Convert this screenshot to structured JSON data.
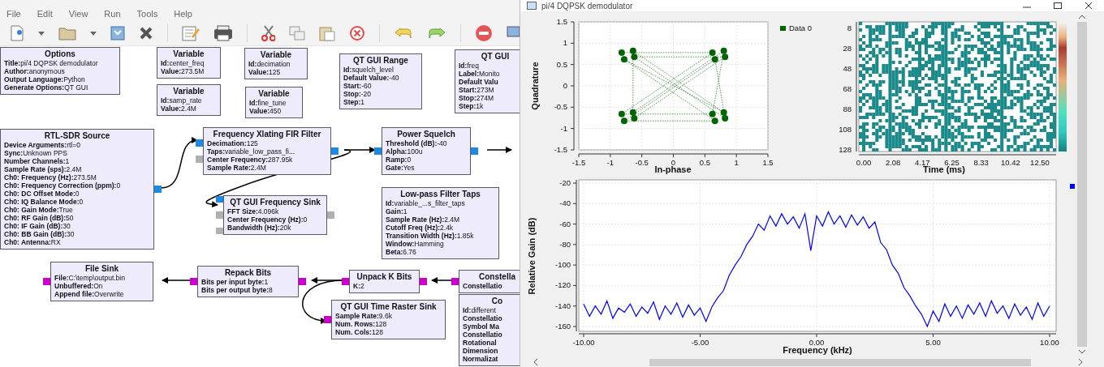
{
  "flowgraph_window": {
    "menu": [
      "File",
      "Edit",
      "View",
      "Run",
      "Tools",
      "Help"
    ]
  },
  "blocks": [
    {
      "title": "Options",
      "params": [
        {
          "label": "Title:",
          "value": "pi/4 DQPSK demodulator"
        },
        {
          "label": "Author:",
          "value": "anonymous"
        },
        {
          "label": "Output Language:",
          "value": "Python"
        },
        {
          "label": "Generate Options:",
          "value": "QT GUI"
        }
      ]
    },
    {
      "title": "Variable",
      "params": [
        {
          "label": "Id:",
          "value": "center_freq"
        },
        {
          "label": "Value:",
          "value": "273.5M"
        }
      ]
    },
    {
      "title": "Variable",
      "params": [
        {
          "label": "Id:",
          "value": "samp_rate"
        },
        {
          "label": "Value:",
          "value": "2.4M"
        }
      ]
    },
    {
      "title": "Variable",
      "params": [
        {
          "label": "Id:",
          "value": "decimation"
        },
        {
          "label": "Value:",
          "value": "125"
        }
      ]
    },
    {
      "title": "Variable",
      "params": [
        {
          "label": "Id:",
          "value": "fine_tune"
        },
        {
          "label": "Value:",
          "value": "450"
        }
      ]
    },
    {
      "title": "QT GUI Range",
      "params": [
        {
          "label": "Id:",
          "value": "squelch_level"
        },
        {
          "label": "Default Value:",
          "value": "-40"
        },
        {
          "label": "Start:",
          "value": "-60"
        },
        {
          "label": "Stop:",
          "value": "-20"
        },
        {
          "label": "Step:",
          "value": "1"
        }
      ]
    },
    {
      "title": "QT GUI",
      "params": [
        {
          "label": "Id:",
          "value": "freq"
        },
        {
          "label": "Label:",
          "value": "Monito"
        },
        {
          "label": "Default Valu"
        },
        {
          "label": "Start:",
          "value": "273M"
        },
        {
          "label": "Stop:",
          "value": "274M"
        },
        {
          "label": "Step:",
          "value": "1k"
        }
      ]
    },
    {
      "title": "RTL-SDR Source",
      "params": [
        {
          "label": "Device Arguments:",
          "value": "rtl=0"
        },
        {
          "label": "Sync:",
          "value": "Unknown PPS"
        },
        {
          "label": "Number Channels:",
          "value": "1"
        },
        {
          "label": "Sample Rate (sps):",
          "value": "2.4M"
        },
        {
          "label": "Ch0: Frequency (Hz):",
          "value": "273.5M"
        },
        {
          "label": "Ch0: Frequency Correction (ppm):",
          "value": "0"
        },
        {
          "label": "Ch0: DC Offset Mode:",
          "value": "0"
        },
        {
          "label": "Ch0: IQ Balance Mode:",
          "value": "0"
        },
        {
          "label": "Ch0: Gain Mode:",
          "value": "True"
        },
        {
          "label": "Ch0: RF Gain (dB):",
          "value": "50"
        },
        {
          "label": "Ch0: IF Gain (dB):",
          "value": "30"
        },
        {
          "label": "Ch0: BB Gain (dB):",
          "value": "30"
        },
        {
          "label": "Ch0: Antenna:",
          "value": "RX"
        }
      ],
      "outputs": [
        {
          "color": "#1e88e5"
        }
      ]
    },
    {
      "title": "Frequency Xlating FIR Filter",
      "params": [
        {
          "label": "Decimation:",
          "value": "125"
        },
        {
          "label": "Taps:",
          "value": "variable_low_pass_fi..."
        },
        {
          "label": "Center Frequency:",
          "value": "287.95k"
        },
        {
          "label": "Sample Rate:",
          "value": "2.4M"
        }
      ],
      "inputs": [
        {
          "color": "#1e88e5"
        },
        {
          "color": "#b0b0b0"
        }
      ],
      "outputs": [
        {
          "color": "#1e88e5"
        }
      ]
    },
    {
      "title": "Power Squelch",
      "params": [
        {
          "label": "Threshold (dB):",
          "value": "-40"
        },
        {
          "label": "Alpha:",
          "value": "100u"
        },
        {
          "label": "Ramp:",
          "value": "0"
        },
        {
          "label": "Gate:",
          "value": "Yes"
        }
      ],
      "inputs": [
        {
          "color": "#1e88e5"
        }
      ],
      "outputs": [
        {
          "color": "#1e88e5"
        }
      ]
    },
    {
      "title": "QT GUI Frequency Sink",
      "params": [
        {
          "label": "FFT Size:",
          "value": "4.096k"
        },
        {
          "label": "Center Frequency (Hz):",
          "value": "0"
        },
        {
          "label": "Bandwidth (Hz):",
          "value": "20k"
        }
      ],
      "inputs": [
        {
          "color": "#1e88e5"
        },
        {
          "color": "#b0b0b0"
        },
        {
          "color": "#b0b0b0"
        }
      ],
      "outputs": [
        {
          "color": "#b0b0b0"
        }
      ]
    },
    {
      "title": "Low-pass Filter Taps",
      "params": [
        {
          "label": "Id:",
          "value": "variable_...s_filter_taps"
        },
        {
          "label": "Gain:",
          "value": "1"
        },
        {
          "label": "Sample Rate (Hz):",
          "value": "2.4M"
        },
        {
          "label": "Cutoff Freq (Hz):",
          "value": "2.4k"
        },
        {
          "label": "Transition Width (Hz):",
          "value": "1.85k"
        },
        {
          "label": "Window:",
          "value": "Hamming"
        },
        {
          "label": "Beta:",
          "value": "6.76"
        }
      ]
    },
    {
      "title": "File Sink",
      "params": [
        {
          "label": "File:",
          "value": "C:\\temp\\output.bin"
        },
        {
          "label": "Unbuffered:",
          "value": "On"
        },
        {
          "label": "Append file:",
          "value": "Overwrite"
        }
      ],
      "inputs": [
        {
          "color": "#cc00cc"
        }
      ]
    },
    {
      "title": "Repack Bits",
      "params": [
        {
          "label": "Bits per input byte:",
          "value": "1"
        },
        {
          "label": "Bits per output byte:",
          "value": "8"
        }
      ],
      "inputs": [
        {
          "color": "#cc00cc"
        }
      ],
      "outputs": [
        {
          "color": "#cc00cc"
        }
      ]
    },
    {
      "title": "Unpack K Bits",
      "params": [
        {
          "label": "K:",
          "value": "2"
        }
      ],
      "inputs": [
        {
          "color": "#cc00cc"
        }
      ],
      "outputs": [
        {
          "color": "#cc00cc"
        }
      ]
    },
    {
      "title": "QT GUI Time Raster Sink",
      "params": [
        {
          "label": "Sample Rate:",
          "value": "9.6k"
        },
        {
          "label": "Num. Rows:",
          "value": "128"
        },
        {
          "label": "Num. Cols:",
          "value": "128"
        }
      ],
      "inputs": [
        {
          "color": "#cc00cc"
        }
      ]
    },
    {
      "title": "Constella",
      "params": [
        {
          "label": "Constellatio"
        }
      ],
      "inputs": [
        {
          "color": "#cc00cc"
        }
      ]
    },
    {
      "title": "Co",
      "params": [
        {
          "label": "Id:",
          "value": "different"
        },
        {
          "label": "Constellatio"
        },
        {
          "label": "Symbol Ma"
        },
        {
          "label": "Constellatio"
        },
        {
          "label": "Rotational"
        },
        {
          "label": "Dimension"
        },
        {
          "label": "Normalizat"
        }
      ]
    }
  ],
  "plot_window": {
    "title": "pi/4 DQPSK demodulator",
    "constellation": {
      "chart_data": {
        "type": "line",
        "xlabel": "In-phase",
        "ylabel": "Quadrature",
        "grid": true,
        "xlim": [
          -1.5,
          1.5
        ],
        "ylim": [
          -1.5,
          1.5
        ],
        "xticks": [
          -1.5,
          -1,
          -0.5,
          0,
          0.5,
          1,
          1.5
        ],
        "yticks": [
          -1.5,
          -1,
          -0.5,
          0,
          0.5,
          1,
          1.5
        ],
        "x": [
          -0.82,
          0.62,
          -0.82,
          0.62,
          0.8,
          -0.64,
          -0.64,
          0.8,
          -0.78,
          0.66,
          -0.78,
          0.66,
          0.82,
          -0.62,
          0.82,
          -0.62
        ],
        "series": [
          {
            "name": "Data 0",
            "color": "#006400",
            "line_style": "dotted",
            "marker": "circle",
            "values": [
              0.78,
              0.78,
              -0.66,
              -0.66,
              0.82,
              -0.62,
              0.82,
              -0.62,
              0.62,
              -0.82,
              -0.82,
              0.62,
              -0.76,
              0.68,
              0.68,
              -0.76
            ]
          }
        ]
      }
    },
    "time_raster": {
      "xlabel": "Time (ms)",
      "x_tick_labels": [
        "0.00",
        "2.08",
        "4.17",
        "6.25",
        "8.33",
        "10.42",
        "12.50"
      ],
      "y_tick_labels": [
        "8",
        "28",
        "48",
        "68",
        "88",
        "108",
        "128"
      ]
    },
    "frequency_sink": {
      "chart_data": {
        "type": "line",
        "xlabel": "Frequency (kHz)",
        "ylabel": "Relative Gain (dB)",
        "grid": true,
        "xlim": [
          -10,
          10
        ],
        "ylim": [
          -160,
          -20
        ],
        "xticks": [
          {
            "value": -10,
            "label": "-10.00"
          },
          {
            "value": -5,
            "label": "-5.00"
          },
          {
            "value": 0,
            "label": "0.00"
          },
          {
            "value": 5,
            "label": "5.00"
          },
          {
            "value": 10,
            "label": "10.00"
          }
        ],
        "yticks": [
          -20,
          -40,
          -60,
          -80,
          -100,
          -120,
          -140,
          -160
        ],
        "x": [
          -10,
          -9.75,
          -9.5,
          -9.25,
          -9,
          -8.75,
          -8.5,
          -8.25,
          -8,
          -7.75,
          -7.5,
          -7.25,
          -7,
          -6.75,
          -6.5,
          -6.25,
          -6,
          -5.75,
          -5.5,
          -5.25,
          -5,
          -4.75,
          -4.5,
          -4.25,
          -4,
          -3.75,
          -3.5,
          -3.25,
          -3,
          -2.75,
          -2.5,
          -2.25,
          -2,
          -1.75,
          -1.5,
          -1.25,
          -1,
          -0.75,
          -0.5,
          -0.25,
          0,
          0.25,
          0.5,
          0.75,
          1,
          1.25,
          1.5,
          1.75,
          2,
          2.25,
          2.5,
          2.75,
          3,
          3.25,
          3.5,
          3.75,
          4,
          4.25,
          4.5,
          4.75,
          5,
          5.25,
          5.5,
          5.75,
          6,
          6.25,
          6.5,
          6.75,
          7,
          7.25,
          7.5,
          7.75,
          8,
          8.25,
          8.5,
          8.75,
          9,
          9.25,
          9.5,
          9.75,
          10
        ],
        "series": [
          {
            "color": "#0000ff",
            "values": [
              -138,
              -150,
              -140,
              -148,
              -135,
              -152,
              -142,
              -146,
              -138,
              -150,
              -141,
              -147,
              -136,
              -153,
              -140,
              -148,
              -137,
              -151,
              -139,
              -149,
              -142,
              -155,
              -141,
              -132,
              -125,
              -110,
              -100,
              -92,
              -80,
              -72,
              -60,
              -66,
              -52,
              -62,
              -50,
              -60,
              -53,
              -64,
              -50,
              -86,
              -52,
              -62,
              -48,
              -60,
              -52,
              -63,
              -51,
              -61,
              -53,
              -64,
              -58,
              -78,
              -85,
              -100,
              -108,
              -122,
              -130,
              -140,
              -148,
              -160,
              -145,
              -155,
              -138,
              -150,
              -140,
              -152,
              -139,
              -148,
              -137,
              -150,
              -135,
              -147,
              -140,
              -152,
              -138,
              -149,
              -141,
              -153,
              -137,
              -150,
              -140
            ]
          }
        ]
      }
    }
  }
}
